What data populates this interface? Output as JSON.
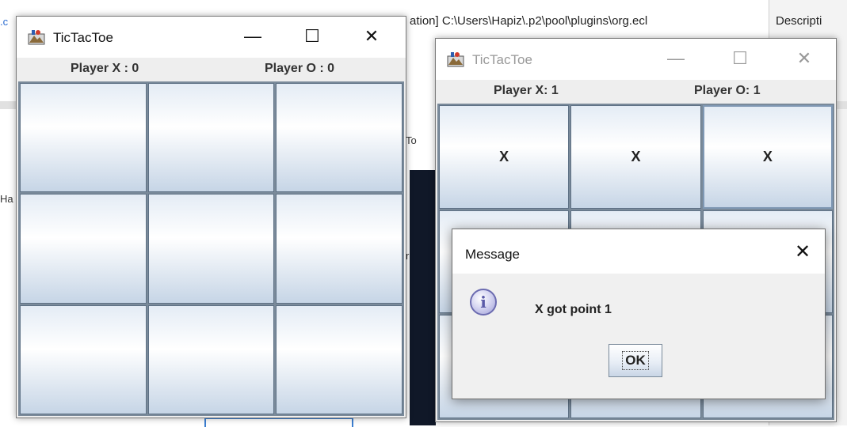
{
  "background": {
    "ide_path_text": "ation] C:\\Users\\Hapiz\\.p2\\pool\\plugins\\org.ecl",
    "description_tab": "Descripti",
    "left_edge_a": ".c",
    "left_edge_b": "Ha"
  },
  "window_left": {
    "title": "TicTacToe",
    "buttons": {
      "minimize": "—",
      "maximize": "☐",
      "close": "✕"
    },
    "score_x": "Player X : 0",
    "score_o": "Player O : 0",
    "board": [
      "",
      "",
      "",
      "",
      "",
      "",
      "",
      "",
      ""
    ]
  },
  "window_right": {
    "title": "TicTacToe",
    "buttons": {
      "minimize": "—",
      "maximize": "☐",
      "close": "✕"
    },
    "score_x": "Player X: 1",
    "score_o": "Player O: 1",
    "board": [
      "X",
      "X",
      "X",
      "",
      "",
      "",
      "",
      "",
      ""
    ]
  },
  "dialog": {
    "title": "Message",
    "close": "✕",
    "icon": "info-icon",
    "icon_glyph": "i",
    "message": "X got point 1",
    "ok_label": "OK"
  }
}
